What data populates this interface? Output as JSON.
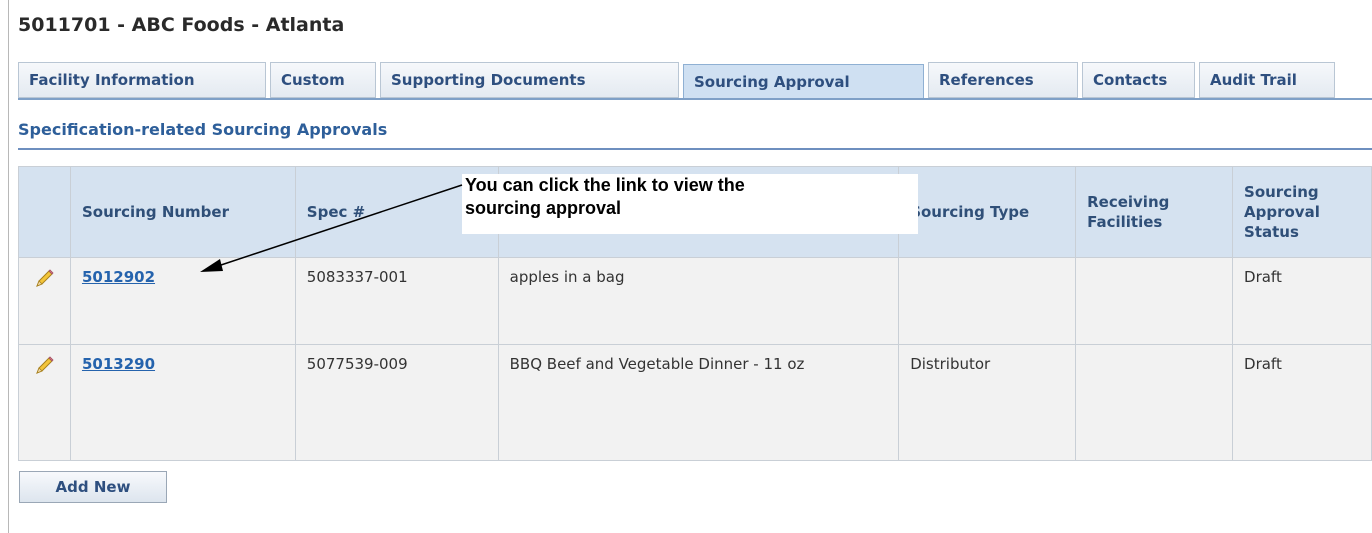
{
  "page": {
    "title": "5011701 - ABC Foods - Atlanta"
  },
  "tabs": [
    {
      "label": "Facility Information"
    },
    {
      "label": "Custom"
    },
    {
      "label": "Supporting Documents"
    },
    {
      "label": "Sourcing Approval",
      "active": true
    },
    {
      "label": "References"
    },
    {
      "label": "Contacts"
    },
    {
      "label": "Audit Trail"
    }
  ],
  "section": {
    "title": "Specification-related Sourcing Approvals"
  },
  "table": {
    "headers": [
      "",
      "Sourcing Number",
      "Spec #",
      "",
      "Sourcing Type",
      "Receiving Facilities",
      "Sourcing Approval Status"
    ],
    "rows": [
      {
        "sourcing_number": "5012902",
        "spec": "5083337-001",
        "description": "apples in a bag",
        "sourcing_type": "",
        "receiving_facilities": "",
        "status": "Draft"
      },
      {
        "sourcing_number": "5013290",
        "spec": "5077539-009",
        "description": "BBQ Beef and Vegetable Dinner - 11 oz",
        "sourcing_type": "Distributor",
        "receiving_facilities": "",
        "status": "Draft"
      }
    ]
  },
  "buttons": {
    "add_new": "Add New"
  },
  "callout": {
    "line1": "You can click the link to view the",
    "line2": "sourcing approval"
  },
  "icons": {
    "edit": "pencil-icon"
  },
  "colors": {
    "tab_active": "#cfe0f2",
    "header_bg": "#d5e2f0",
    "link": "#2563ad",
    "section_title": "#2e5f9a"
  }
}
